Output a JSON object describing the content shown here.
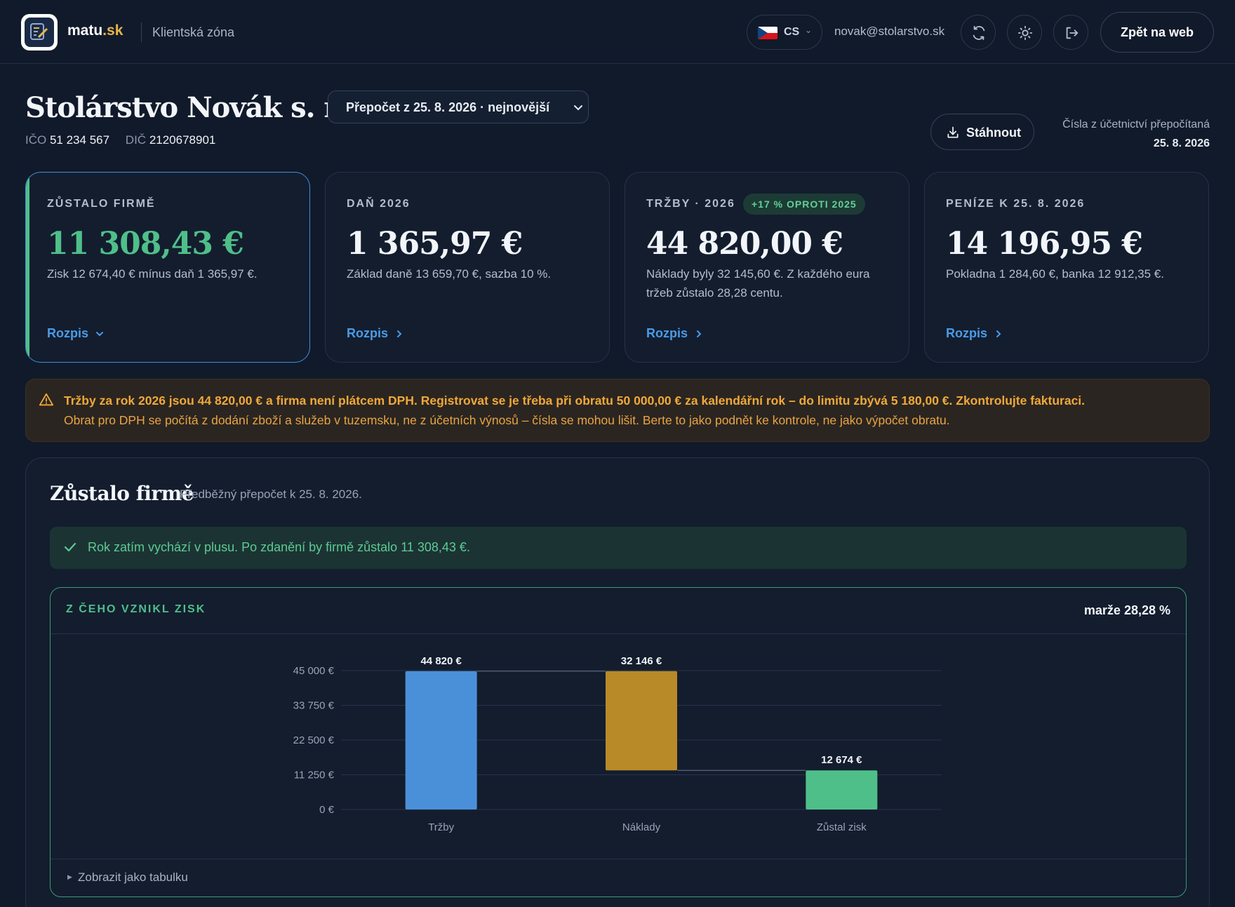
{
  "header": {
    "brand_name": "matu",
    "brand_tld": ".sk",
    "zone_label": "Klientská zóna",
    "language_code": "CS",
    "user_email": "novak@stolarstvo.sk",
    "back_button": "Zpět na web"
  },
  "company": {
    "name": "Stolárstvo Novák s. r. o.",
    "recalc_select": "Přepočet z 25. 8. 2026 · nejnovější",
    "ico_label": "IČO",
    "ico": "51 234 567",
    "dic_label": "DIČ",
    "dic": "2120678901",
    "download_label": "Stáhnout",
    "recalc_note": "Čísla z účetnictví přepočítaná",
    "recalc_date": "25. 8. 2026"
  },
  "cards": [
    {
      "label": "ZŮSTALO FIRMĚ",
      "value": "11 308,43 €",
      "sub": "Zisk 12 674,40 € mínus daň 1 365,97 €.",
      "link": "Rozpis"
    },
    {
      "label": "DAŇ 2026",
      "value": "1 365,97 €",
      "sub": "Základ daně 13 659,70 €, sazba 10 %.",
      "link": "Rozpis"
    },
    {
      "label": "TRŽBY · 2026",
      "badge": "+17 % OPROTI 2025",
      "value": "44 820,00 €",
      "sub": "Náklady byly 32 145,60 €. Z každého eura tržeb zůstalo 28,28 centu.",
      "link": "Rozpis"
    },
    {
      "label": "PENÍZE K 25. 8. 2026",
      "value": "14 196,95 €",
      "sub": "Pokladna 1 284,60 €, banka 12 912,35 €.",
      "link": "Rozpis"
    }
  ],
  "alert": {
    "strong": "Tržby za rok 2026 jsou 44 820,00 € a firma není plátcem DPH. Registrovat se je třeba při obratu 50 000,00 € za kalendářní rok – do limitu zbývá 5 180,00 €. Zkontrolujte fakturaci.",
    "text": "Obrat pro DPH se počítá z dodání zboží a služeb v tuzemsku, ne z účetních výnosů – čísla se mohou lišit. Berte to jako podnět ke kontrole, ne jako výpočet obratu."
  },
  "panel": {
    "title": "Zůstalo firmě",
    "subtitle": "Předběžný přepočet k 25. 8. 2026.",
    "success": "Rok zatím vychází v plusu. Po zdanění by firmě zůstalo 11 308,43 €.",
    "chart_title": "Z ČEHO VZNIKL ZISK",
    "margin_label": "marže 28,28 %",
    "table_toggle": "Zobrazit jako tabulku"
  },
  "chart_data": {
    "type": "bar",
    "categories": [
      "Tržby",
      "Náklady",
      "Zůstal zisk"
    ],
    "values": [
      44820,
      32146,
      12674
    ],
    "value_labels": [
      "44 820 €",
      "32 146 €",
      "12 674 €"
    ],
    "colors": [
      "#4a90d9",
      "#b88a28",
      "#4fbf89"
    ],
    "y_ticks": [
      "0 €",
      "11 250 €",
      "22 500 €",
      "33 750 €",
      "45 000 €"
    ],
    "y_tick_values": [
      0,
      11250,
      22500,
      33750,
      45000
    ],
    "ylim": [
      0,
      45000
    ],
    "grid": true,
    "waterfall": true
  }
}
